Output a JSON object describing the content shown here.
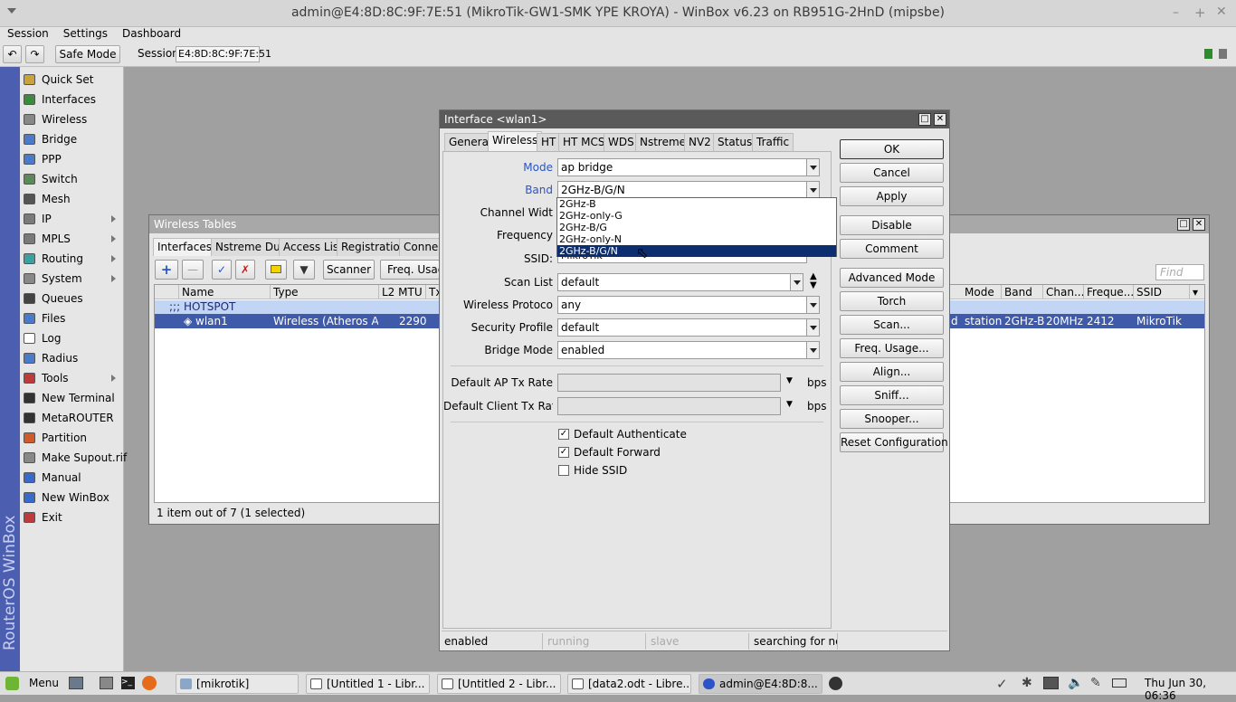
{
  "window_title": "admin@E4:8D:8C:9F:7E:51 (MikroTik-GW1-SMK YPE KROYA) - WinBox v6.23 on RB951G-2HnD (mipsbe)",
  "menubar": [
    "Session",
    "Settings",
    "Dashboard"
  ],
  "toolbar": {
    "undo": "↶",
    "redo": "↷",
    "safe_mode": "Safe Mode",
    "session_label": "Session",
    "session_value": "E4:8D:8C:9F:7E:51"
  },
  "side_brand": "RouterOS WinBox",
  "sidebar": [
    {
      "label": "Quick Set",
      "icon": "quick-set-icon",
      "color": "#c9a23c"
    },
    {
      "label": "Interfaces",
      "icon": "interfaces-icon",
      "color": "#3c8a3c"
    },
    {
      "label": "Wireless",
      "icon": "wireless-icon",
      "color": "#888888"
    },
    {
      "label": "Bridge",
      "icon": "bridge-icon",
      "color": "#4a7ac9"
    },
    {
      "label": "PPP",
      "icon": "ppp-icon",
      "color": "#4a7ac9"
    },
    {
      "label": "Switch",
      "icon": "switch-icon",
      "color": "#5a8a5a"
    },
    {
      "label": "Mesh",
      "icon": "mesh-icon",
      "color": "#555555"
    },
    {
      "label": "IP",
      "icon": "ip-icon",
      "color": "#7a7a7a",
      "sub": true
    },
    {
      "label": "MPLS",
      "icon": "mpls-icon",
      "color": "#7a7a7a",
      "sub": true
    },
    {
      "label": "Routing",
      "icon": "routing-icon",
      "color": "#3aa0a0",
      "sub": true
    },
    {
      "label": "System",
      "icon": "system-icon",
      "color": "#888888",
      "sub": true
    },
    {
      "label": "Queues",
      "icon": "queues-icon",
      "color": "#444444"
    },
    {
      "label": "Files",
      "icon": "files-icon",
      "color": "#4a7ac9"
    },
    {
      "label": "Log",
      "icon": "log-icon",
      "color": "#ffffff"
    },
    {
      "label": "Radius",
      "icon": "radius-icon",
      "color": "#4a7ac9"
    },
    {
      "label": "Tools",
      "icon": "tools-icon",
      "color": "#c03a3a",
      "sub": true
    },
    {
      "label": "New Terminal",
      "icon": "terminal-icon",
      "color": "#333333"
    },
    {
      "label": "MetaROUTER",
      "icon": "metarouter-icon",
      "color": "#333333"
    },
    {
      "label": "Partition",
      "icon": "partition-icon",
      "color": "#d05a2a"
    },
    {
      "label": "Make Supout.rif",
      "icon": "supout-icon",
      "color": "#888888"
    },
    {
      "label": "Manual",
      "icon": "manual-icon",
      "color": "#3a6ac9"
    },
    {
      "label": "New WinBox",
      "icon": "winbox-icon",
      "color": "#3a6ac9"
    },
    {
      "label": "Exit",
      "icon": "exit-icon",
      "color": "#c03a3a"
    }
  ],
  "wireless_tables": {
    "title": "Wireless Tables",
    "tabs": [
      "Interfaces",
      "Nstreme Dual",
      "Access List",
      "Registration",
      "Connect"
    ],
    "tools": {
      "scanner": "Scanner",
      "freq_usage": "Freq. Usag",
      "find_placeholder": "Find"
    },
    "left_columns": [
      "Name",
      "Type",
      "L2 MTU",
      "Tx"
    ],
    "right_columns": [
      "Mode",
      "Band",
      "Chan...",
      "Freque...",
      "SSID"
    ],
    "group_row": ";;; HOTSPOT",
    "row": {
      "name": "wlan1",
      "type": "Wireless (Atheros AR...",
      "l2mtu": "2290",
      "partial": "d",
      "mode": "station",
      "band": "2GHz-B",
      "channel": "20MHz",
      "frequency": "2412",
      "ssid": "MikroTik"
    },
    "status": "1 item out of 7 (1 selected)"
  },
  "dialog": {
    "title": "Interface <wlan1>",
    "tabs": [
      "General",
      "Wireless",
      "HT",
      "HT MCS",
      "WDS",
      "Nstreme",
      "NV2",
      "Status",
      "Traffic"
    ],
    "active_tab": "Wireless",
    "fields": {
      "mode_label": "Mode",
      "mode_value": "ap bridge",
      "band_label": "Band",
      "band_value": "2GHz-B/G/N",
      "channel_width_label": "Channel Widt",
      "frequency_label": "Frequency",
      "ssid_label": "SSID:",
      "ssid_value": "MikroTik",
      "scan_list_label": "Scan List",
      "scan_list_value": "default",
      "wireless_protocol_label": "Wireless Protoco",
      "wireless_protocol_value": "any",
      "security_profile_label": "Security Profile",
      "security_profile_value": "default",
      "bridge_mode_label": "Bridge Mode",
      "bridge_mode_value": "enabled",
      "ap_tx_label": "Default AP Tx Rate",
      "client_tx_label": "Default Client Tx Rat",
      "bps": "bps"
    },
    "band_options": [
      "2GHz-B",
      "2GHz-only-G",
      "2GHz-B/G",
      "2GHz-only-N",
      "2GHz-B/G/N"
    ],
    "checkboxes": [
      {
        "label": "Default Authenticate",
        "checked": true
      },
      {
        "label": "Default Forward",
        "checked": true
      },
      {
        "label": "Hide SSID",
        "checked": false
      }
    ],
    "buttons": [
      "OK",
      "Cancel",
      "Apply",
      "Disable",
      "Comment",
      "Advanced Mode",
      "Torch",
      "Scan...",
      "Freq. Usage...",
      "Align...",
      "Sniff...",
      "Snooper...",
      "Reset Configuration"
    ],
    "status": [
      "enabled",
      "running",
      "slave",
      "searching for ne."
    ]
  },
  "taskbar": {
    "menu": "Menu",
    "tasks": [
      "[mikrotik]",
      "[Untitled 1 - Libr...",
      "[Untitled 2 - Libr...",
      "[data2.odt - Libre...",
      "admin@E4:8D:8..."
    ],
    "clock": "Thu Jun 30, 06:36"
  }
}
